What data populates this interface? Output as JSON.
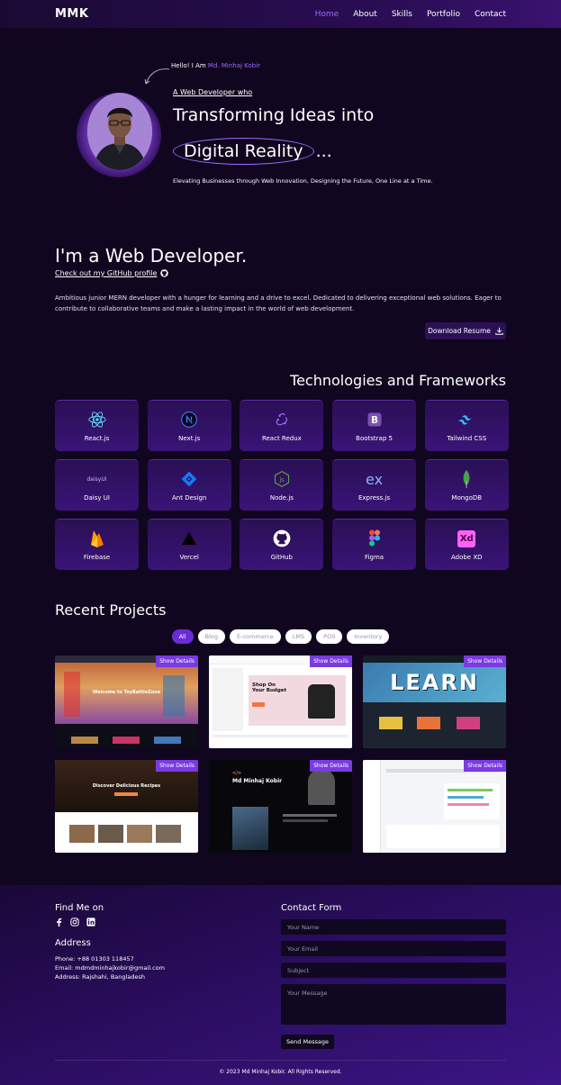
{
  "nav": {
    "logo": "MMK",
    "links": [
      {
        "label": "Home",
        "active": true
      },
      {
        "label": "About"
      },
      {
        "label": "Skills"
      },
      {
        "label": "Portfolio"
      },
      {
        "label": "Contact"
      }
    ]
  },
  "hero": {
    "hello_prefix": "Hello! I Am ",
    "hello_name": "Md. Minhaj Kobir",
    "role": "A Web Developer who",
    "title": "Transforming Ideas into",
    "highlight": "Digital Reality",
    "ellipsis": "...",
    "tagline": "Elevating Businesses through Web Innovation, Designing the Future, One Line at a Time."
  },
  "about": {
    "title": "I'm a Web Developer.",
    "github_link": "Check out my GitHub profile",
    "text": "Ambitious junior MERN developer with a hunger for learning and a drive to excel. Dedicated to delivering exceptional web solutions. Eager to contribute to collaborative teams and make a lasting impact in the world of web development.",
    "download": "Download Resume"
  },
  "tech": {
    "title": "Technologies and Frameworks",
    "items": [
      {
        "label": "React.js",
        "icon": "react-icon",
        "color": "#61dafb"
      },
      {
        "label": "Next.js",
        "icon": "nextjs-icon",
        "color": "#4a7dff"
      },
      {
        "label": "React Redux",
        "icon": "redux-icon",
        "color": "#9b6bff"
      },
      {
        "label": "Bootstrap 5",
        "icon": "bootstrap-icon",
        "color": "#7952b3"
      },
      {
        "label": "Tailwind CSS",
        "icon": "tailwind-icon",
        "color": "#38bdf8"
      },
      {
        "label": "Daisy UI",
        "icon": "daisyui-icon",
        "color": "#c9b6ff",
        "logo_text": "daisyUI"
      },
      {
        "label": "Ant Design",
        "icon": "antdesign-icon",
        "color": "#1677ff"
      },
      {
        "label": "Node.js",
        "icon": "nodejs-icon",
        "color": "#5fa04e"
      },
      {
        "label": "Express.js",
        "icon": "express-icon",
        "color": "#8ab4f8",
        "logo_text": "ex"
      },
      {
        "label": "MongoDB",
        "icon": "mongodb-icon",
        "color": "#47a248"
      },
      {
        "label": "Firebase",
        "icon": "firebase-icon",
        "color": "#ffca28"
      },
      {
        "label": "Vercel",
        "icon": "vercel-icon",
        "color": "#000000"
      },
      {
        "label": "GitHub",
        "icon": "github-icon",
        "color": "#ffffff"
      },
      {
        "label": "Figma",
        "icon": "figma-icon",
        "color": "#f24e1e"
      },
      {
        "label": "Adobe XD",
        "icon": "adobexd-icon",
        "color": "#ff61f6",
        "logo_text": "Xd"
      }
    ]
  },
  "projects": {
    "title": "Recent Projects",
    "filters": [
      {
        "label": "All",
        "active": true
      },
      {
        "label": "Blog"
      },
      {
        "label": "E-commerce"
      },
      {
        "label": "LMS"
      },
      {
        "label": "POS"
      },
      {
        "label": "Inventory"
      }
    ],
    "show_details": "Show Details",
    "cards": [
      {
        "caption": "Welcome to ToyBattleZone",
        "theme": "toy"
      },
      {
        "caption": "Shop On Your Budget",
        "theme": "shop"
      },
      {
        "caption": "LEARN",
        "theme": "learn"
      },
      {
        "caption": "Discover Delicious Recipes",
        "theme": "recipe"
      },
      {
        "caption": "Md Minhaj Kobir",
        "theme": "blog"
      },
      {
        "caption": "",
        "theme": "dashboard"
      }
    ]
  },
  "footer": {
    "find_me": "Find Me on",
    "address_title": "Address",
    "phone": "Phone: +88 01303 118457",
    "email": "Email: mdmdminhajkobir@gmail.com",
    "address": "Address: Rajshahi, Bangladesh",
    "contact_title": "Contact Form",
    "placeholders": {
      "name": "Your Name",
      "email": "Your Email",
      "subject": "Subject",
      "message": "Your Message"
    },
    "send": "Send Message",
    "copyright": "© 2023 Md Minhaj Kobir. All Rights Reserved."
  }
}
